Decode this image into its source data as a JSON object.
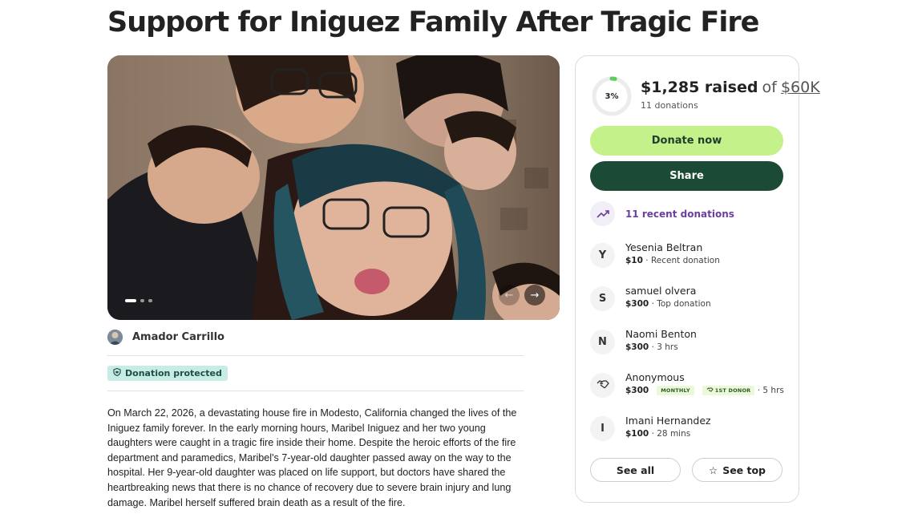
{
  "page": {
    "title": "Support for Iniguez Family After Tragic Fire"
  },
  "photo": {
    "carousel_dots": 3,
    "active_dot": 0
  },
  "organizer": {
    "name": "Amador Carrillo"
  },
  "badge": {
    "label": "Donation protected"
  },
  "story": {
    "text": "On March 22, 2026, a devastating house fire in Modesto, California changed the lives of the Iniguez family forever. In the early morning hours, Maribel Iniguez and her two young daughters were caught in a tragic fire inside their home. Despite the heroic efforts of the fire department and paramedics, Maribel's 7-year-old daughter passed away on the way to the hospital. Her 9-year-old daughter was placed on life support, but doctors have shared the heartbreaking news that there is no chance of recovery due to severe brain injury and lung damage. Maribel herself suffered brain death as a result of the fire."
  },
  "fundraiser": {
    "percent": 3,
    "percent_label": "3%",
    "raised": "$1,285 raised",
    "of": "of",
    "goal": "$60K",
    "donations": "11 donations",
    "donate_label": "Donate now",
    "share_label": "Share",
    "recent_label": "11 recent donations",
    "see_all_label": "See all",
    "see_top_label": "See top"
  },
  "donors": [
    {
      "initial": "Y",
      "name": "Yesenia Beltran",
      "amount": "$10",
      "note": "· Recent donation"
    },
    {
      "initial": "S",
      "name": "samuel olvera",
      "amount": "$300",
      "note": "· Top donation"
    },
    {
      "initial": "N",
      "name": "Naomi Benton",
      "amount": "$300",
      "note": "· 3 hrs"
    },
    {
      "initial": "",
      "name": "Anonymous",
      "amount": "$300",
      "badges": [
        "MONTHLY",
        "1ST DONOR"
      ],
      "note": "· 5 hrs"
    },
    {
      "initial": "I",
      "name": "Imani Hernandez",
      "amount": "$100",
      "note": "· 28 mins"
    }
  ],
  "colors": {
    "donate_bg": "#c4f18a",
    "share_bg": "#1c4b35",
    "progress": "#5fcc5f",
    "accent_purple": "#6b3fa0",
    "protected_bg": "#c7ece5"
  }
}
